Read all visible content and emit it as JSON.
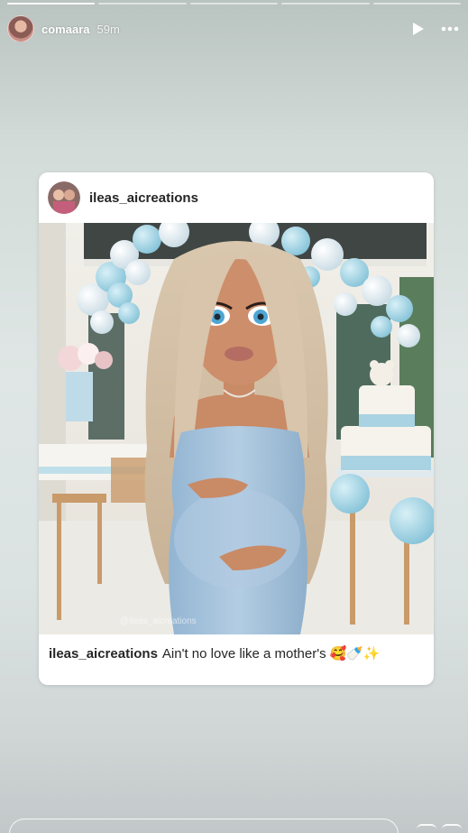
{
  "story": {
    "username": "comaara",
    "time_ago": "59m",
    "progress_segments": 5,
    "active_segment": 1
  },
  "post": {
    "username": "ileas_aicreations",
    "caption_user": "ileas_aicreations",
    "caption_text": "Ain't no love like a mother's",
    "caption_emojis": "🥰🍼✨",
    "image_watermark": "@ileas_aicreations"
  },
  "icons": {
    "play": "play-icon",
    "more": "more-icon"
  },
  "colors": {
    "background": "#dfe6e5",
    "card": "#ffffff",
    "balloon_blue": "#a9d8e6",
    "dress_blue": "#a8c6de"
  }
}
